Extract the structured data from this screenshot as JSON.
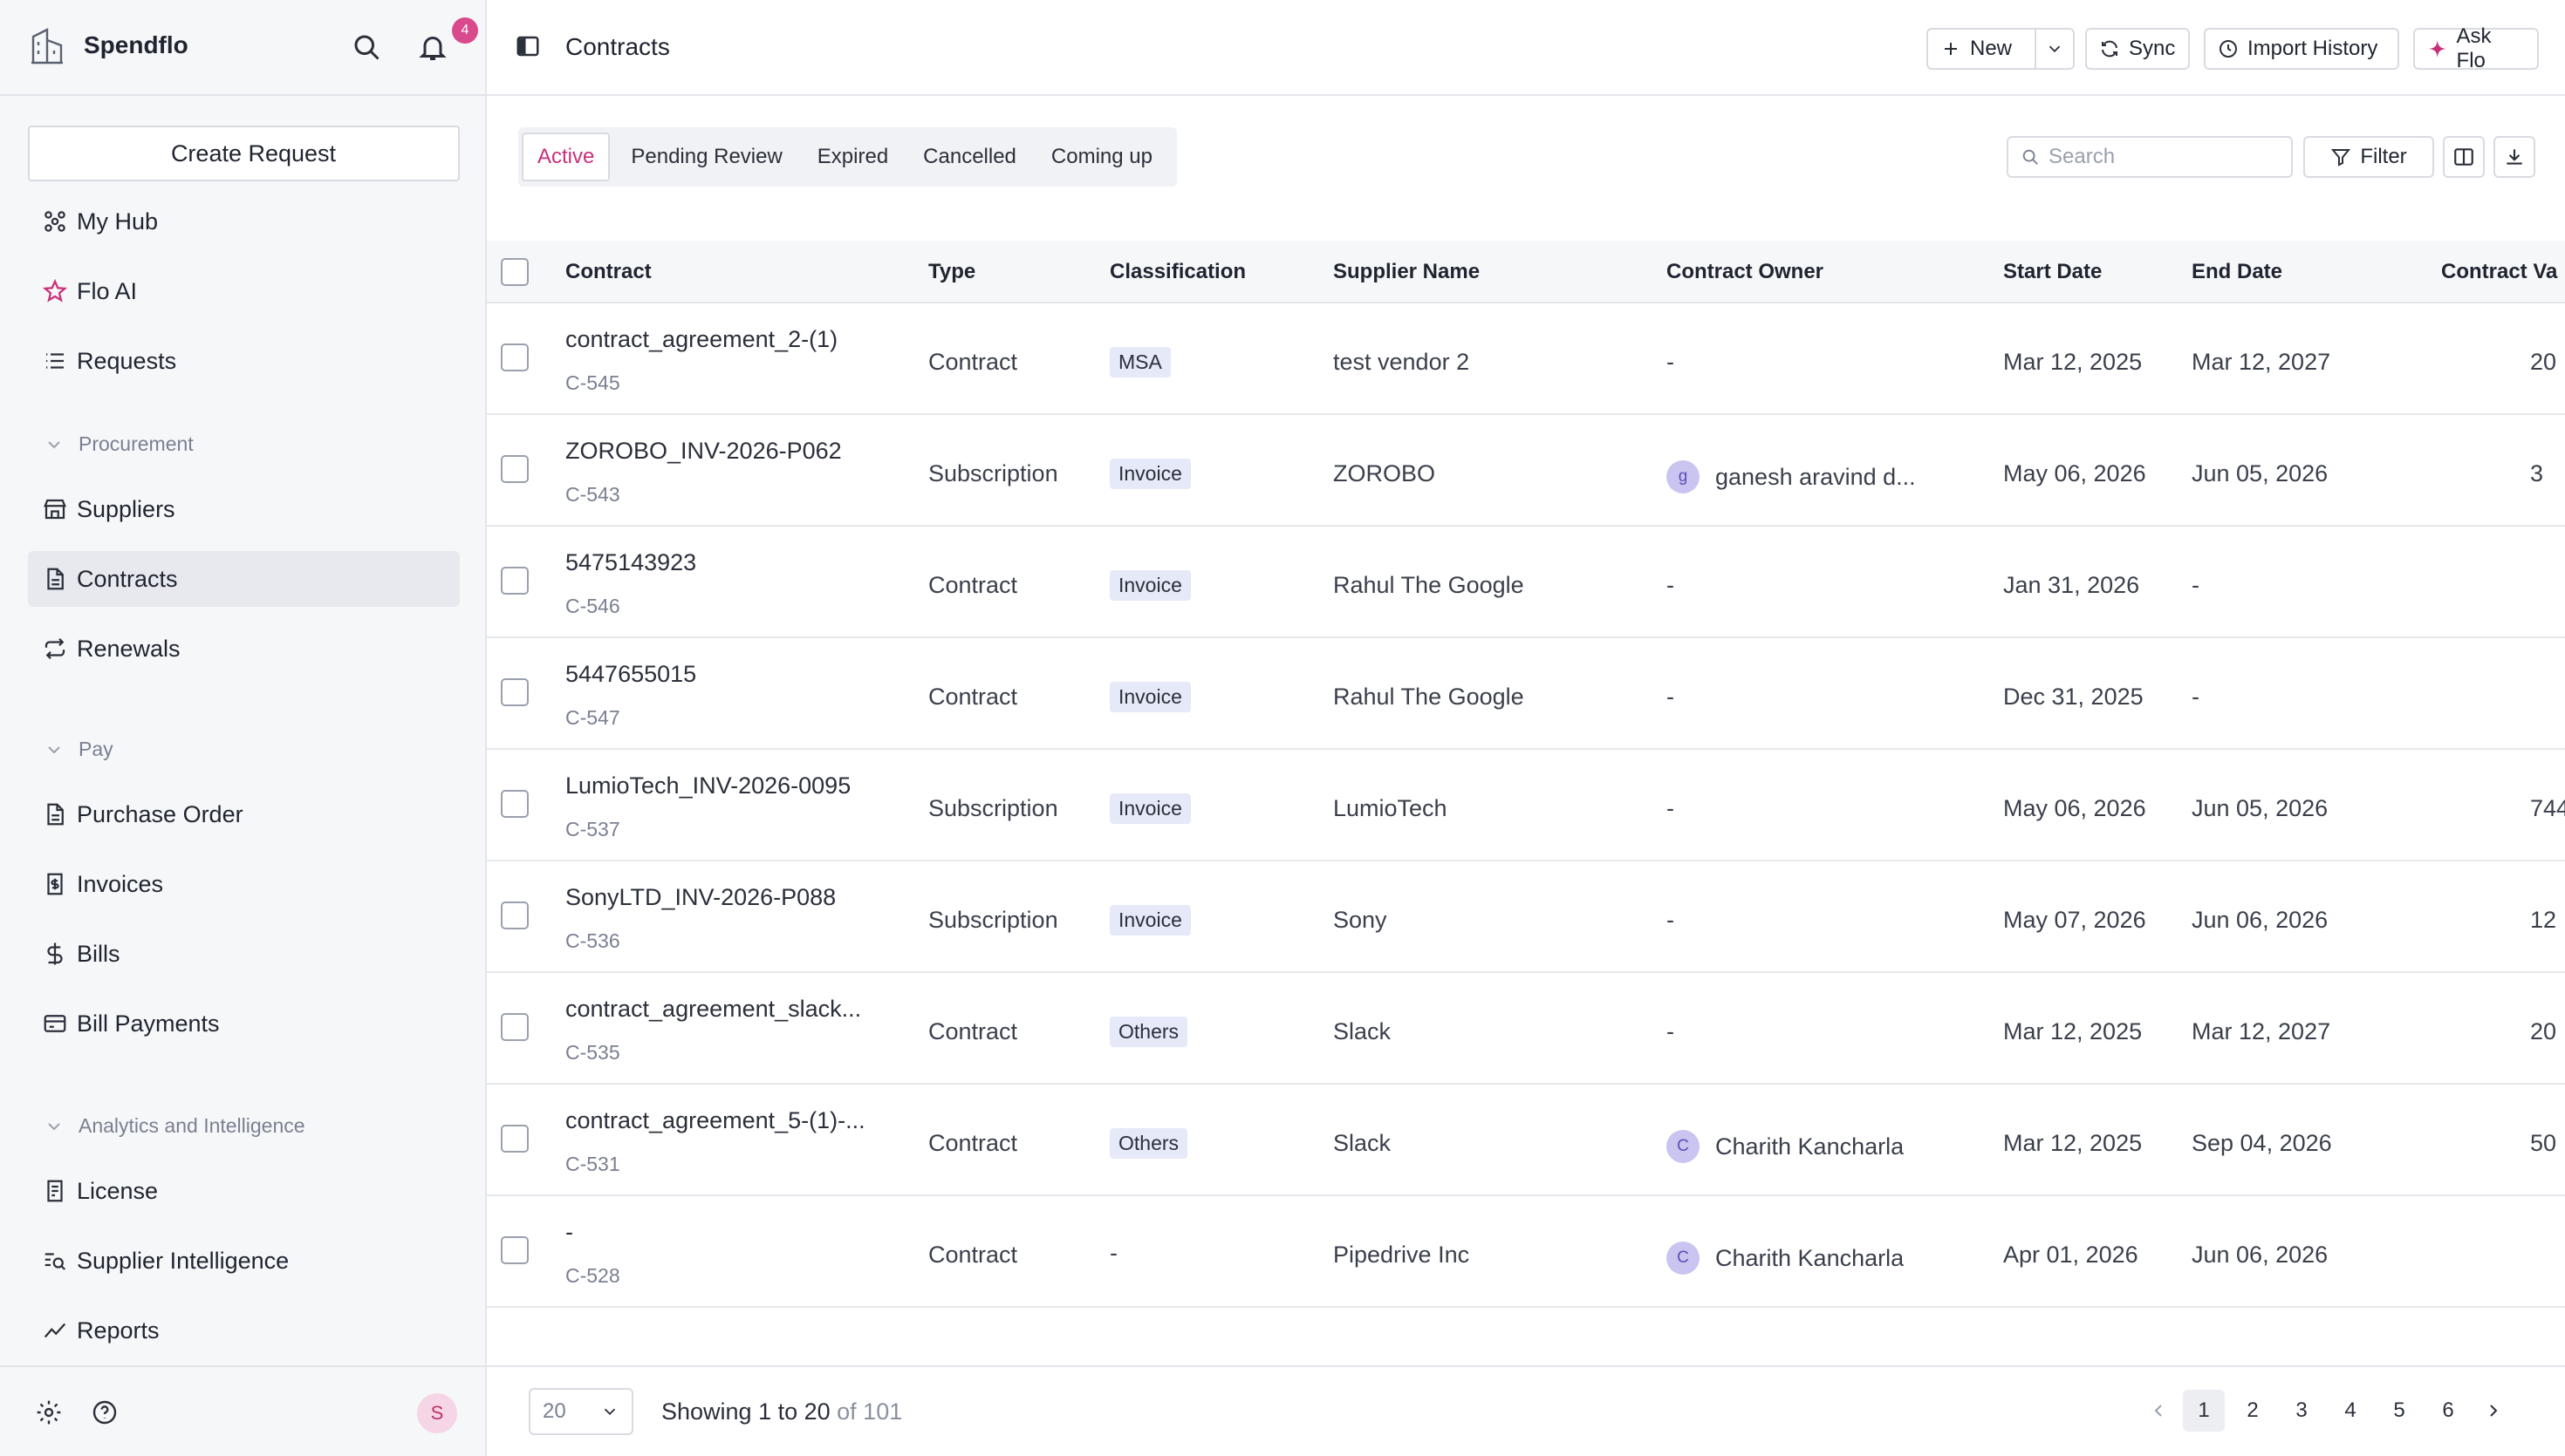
{
  "brand": {
    "name": "Spendflo",
    "notification_count": "4"
  },
  "sidebar": {
    "create_request": "Create Request",
    "items_top": [
      {
        "label": "My Hub",
        "icon": "hub-icon"
      },
      {
        "label": "Flo AI",
        "icon": "star-icon"
      },
      {
        "label": "Requests",
        "icon": "list-icon"
      }
    ],
    "section_procurement": "Procurement",
    "items_procurement": [
      {
        "label": "Suppliers",
        "icon": "store-icon"
      },
      {
        "label": "Contracts",
        "icon": "document-icon",
        "active": true
      },
      {
        "label": "Renewals",
        "icon": "repeat-icon"
      }
    ],
    "section_pay": "Pay",
    "items_pay": [
      {
        "label": "Purchase Order",
        "icon": "document-icon"
      },
      {
        "label": "Invoices",
        "icon": "receipt-icon"
      },
      {
        "label": "Bills",
        "icon": "dollar-icon"
      },
      {
        "label": "Bill Payments",
        "icon": "card-icon"
      }
    ],
    "section_analytics": "Analytics and Intelligence",
    "items_analytics": [
      {
        "label": "License",
        "icon": "license-icon"
      },
      {
        "label": "Supplier Intelligence",
        "icon": "search-list-icon"
      },
      {
        "label": "Reports",
        "icon": "trend-icon"
      }
    ],
    "avatar_initial": "S"
  },
  "header": {
    "title": "Contracts",
    "new_label": "New",
    "sync_label": "Sync",
    "import_history_label": "Import History",
    "ask_flo_label": "Ask Flo"
  },
  "tabs": [
    "Active",
    "Pending Review",
    "Expired",
    "Cancelled",
    "Coming up"
  ],
  "active_tab": "Active",
  "toolbar": {
    "search_placeholder": "Search",
    "filter_label": "Filter"
  },
  "table": {
    "columns": {
      "contract": "Contract",
      "type": "Type",
      "classification": "Classification",
      "supplier": "Supplier Name",
      "owner": "Contract Owner",
      "start": "Start Date",
      "end": "End Date",
      "value": "Contract Va"
    },
    "rows": [
      {
        "name": "contract_agreement_2-(1)",
        "id": "C-545",
        "type": "Contract",
        "classification": "MSA",
        "supplier": "test vendor 2",
        "owner": "-",
        "owner_initial": "",
        "start": "Mar 12, 2025",
        "end": "Mar 12, 2027",
        "value": "20"
      },
      {
        "name": "ZOROBO_INV-2026-P062",
        "id": "C-543",
        "type": "Subscription",
        "classification": "Invoice",
        "supplier": "ZOROBO",
        "owner": "ganesh aravind d...",
        "owner_initial": "g",
        "start": "May 06, 2026",
        "end": "Jun 05, 2026",
        "value": "3"
      },
      {
        "name": "5475143923",
        "id": "C-546",
        "type": "Contract",
        "classification": "Invoice",
        "supplier": "Rahul The Google",
        "owner": "-",
        "owner_initial": "",
        "start": "Jan 31, 2026",
        "end": "-",
        "value": ""
      },
      {
        "name": "5447655015",
        "id": "C-547",
        "type": "Contract",
        "classification": "Invoice",
        "supplier": "Rahul The Google",
        "owner": "-",
        "owner_initial": "",
        "start": "Dec 31, 2025",
        "end": "-",
        "value": ""
      },
      {
        "name": "LumioTech_INV-2026-0095",
        "id": "C-537",
        "type": "Subscription",
        "classification": "Invoice",
        "supplier": "LumioTech",
        "owner": "-",
        "owner_initial": "",
        "start": "May 06, 2026",
        "end": "Jun 05, 2026",
        "value": "744"
      },
      {
        "name": "SonyLTD_INV-2026-P088",
        "id": "C-536",
        "type": "Subscription",
        "classification": "Invoice",
        "supplier": "Sony",
        "owner": "-",
        "owner_initial": "",
        "start": "May 07, 2026",
        "end": "Jun 06, 2026",
        "value": "12"
      },
      {
        "name": "contract_agreement_slack...",
        "id": "C-535",
        "type": "Contract",
        "classification": "Others",
        "supplier": "Slack",
        "owner": "-",
        "owner_initial": "",
        "start": "Mar 12, 2025",
        "end": "Mar 12, 2027",
        "value": "20"
      },
      {
        "name": "contract_agreement_5-(1)-...",
        "id": "C-531",
        "type": "Contract",
        "classification": "Others",
        "supplier": "Slack",
        "owner": "Charith Kancharla",
        "owner_initial": "C",
        "start": "Mar 12, 2025",
        "end": "Sep 04, 2026",
        "value": "50"
      },
      {
        "name": "-",
        "id": "C-528",
        "type": "Contract",
        "classification": "-",
        "supplier": "Pipedrive Inc",
        "owner": "Charith Kancharla",
        "owner_initial": "C",
        "start": "Apr 01, 2026",
        "end": "Jun 06, 2026",
        "value": ""
      }
    ]
  },
  "pagination": {
    "page_size": "20",
    "showing_prefix": "Showing 1 to 20",
    "showing_suffix": "of 101",
    "pages": [
      "1",
      "2",
      "3",
      "4",
      "5",
      "6"
    ],
    "current_page": "1"
  },
  "colors": {
    "accent": "#c8307a",
    "badge": "#d94a8c",
    "chip": "#e6e9f7",
    "owner_avatar": "#c9c4f0"
  }
}
